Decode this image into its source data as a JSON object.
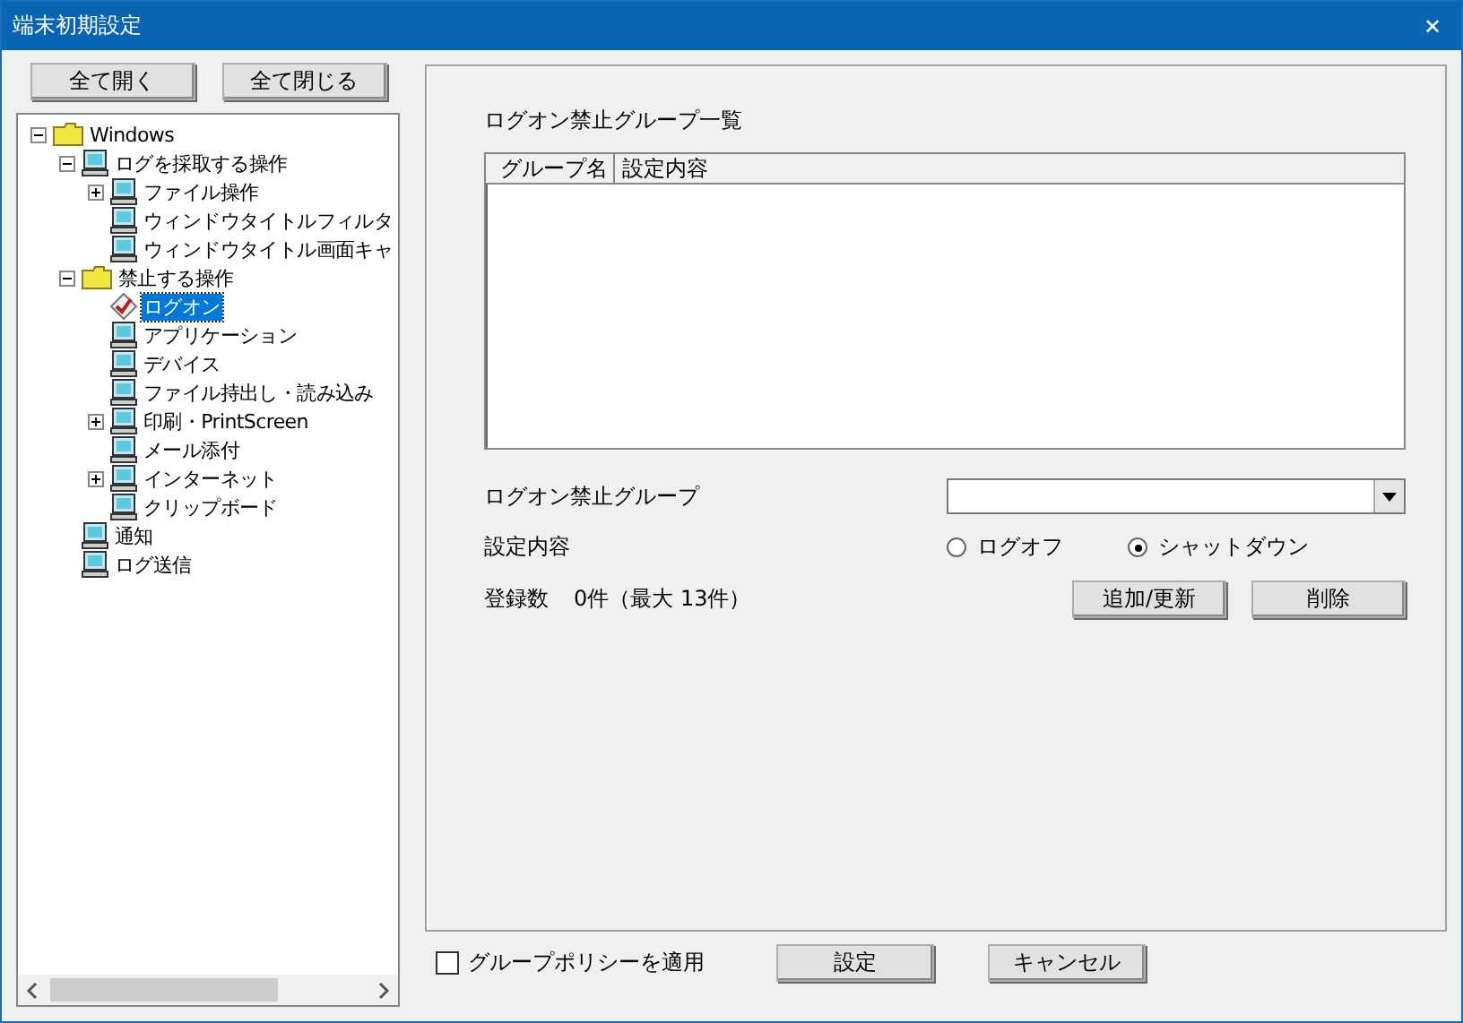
{
  "window": {
    "title": "端末初期設定",
    "close": "✕"
  },
  "tree_buttons": [
    "全て開く",
    "全て閉じる"
  ],
  "tree": [
    {
      "label": "Windows",
      "kind": "folder",
      "expanded": true,
      "selected": false,
      "children": [
        {
          "label": "ログを採取する操作",
          "kind": "computer",
          "expanded": true,
          "selected": false,
          "children": [
            {
              "label": "ファイル操作",
              "kind": "computer",
              "expanded": false,
              "selected": false
            },
            {
              "label": "ウィンドウタイトルフィルタ",
              "kind": "computer",
              "selected": false
            },
            {
              "label": "ウィンドウタイトル画面キャ",
              "kind": "computer",
              "selected": false
            }
          ]
        },
        {
          "label": "禁止する操作",
          "kind": "folder",
          "expanded": true,
          "selected": false,
          "children": [
            {
              "label": "ログオン",
              "kind": "logon",
              "selected": true
            },
            {
              "label": "アプリケーション",
              "kind": "computer",
              "selected": false
            },
            {
              "label": "デバイス",
              "kind": "computer",
              "selected": false
            },
            {
              "label": "ファイル持出し・読み込み",
              "kind": "computer",
              "selected": false
            },
            {
              "label": "印刷・PrintScreen",
              "kind": "computer",
              "expanded": false,
              "selected": false
            },
            {
              "label": "メール添付",
              "kind": "computer",
              "selected": false
            },
            {
              "label": "インターネット",
              "kind": "computer",
              "expanded": false,
              "selected": false
            },
            {
              "label": "クリップボード",
              "kind": "computer",
              "selected": false
            }
          ]
        },
        {
          "label": "通知",
          "kind": "computer",
          "selected": false
        },
        {
          "label": "ログ送信",
          "kind": "computer",
          "selected": false
        }
      ]
    }
  ],
  "panel": {
    "list_title": "ログオン禁止グループ一覧",
    "table": {
      "columns": [
        "グループ名",
        "設定内容"
      ]
    },
    "group_label": "ログオン禁止グループ",
    "setting_label": "設定内容",
    "options": [
      {
        "label": "ログオフ",
        "selected": false
      },
      {
        "label": "シャットダウン",
        "selected": true
      }
    ],
    "count_label": "登録数",
    "count_value": "0件（最大 13件）",
    "buttons": [
      "追加/更新",
      "削除"
    ]
  },
  "footer": {
    "checkbox": {
      "label": "グループポリシーを適用",
      "checked": false
    },
    "buttons": [
      "設定",
      "キャンセル"
    ]
  }
}
